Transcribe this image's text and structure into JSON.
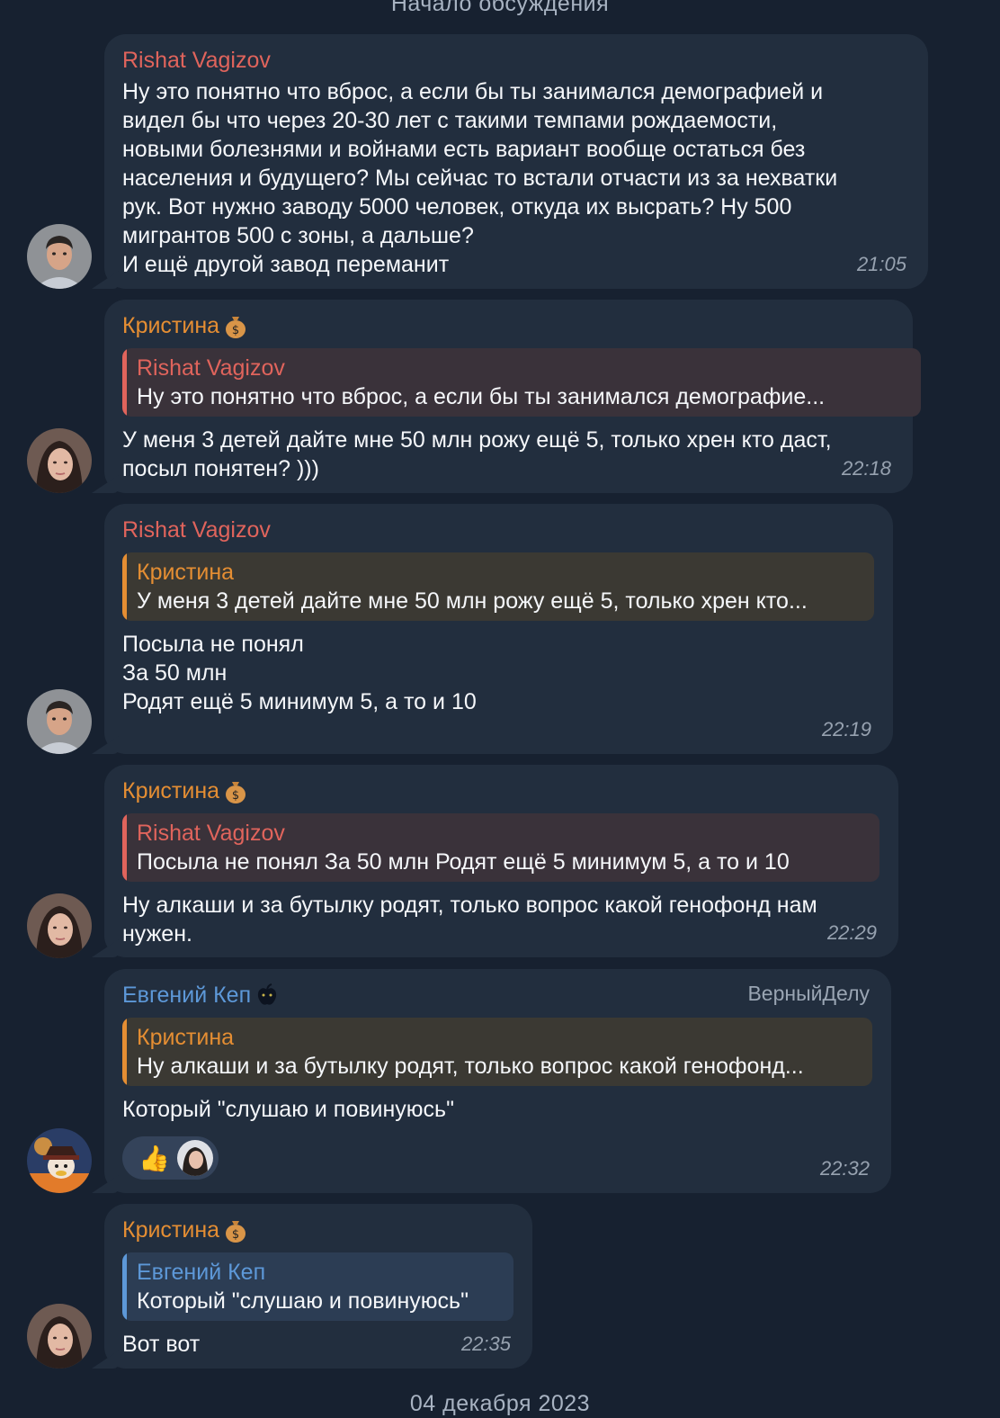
{
  "date_separators": {
    "top": "Начало обсуждения",
    "bottom": "04 декабря 2023"
  },
  "messages": [
    {
      "sender": "Rishat Vagizov",
      "text": "Ну это понятно что вброс, а если бы ты занимался демографией и\nвидел бы что через 20-30 лет с такими темпами рождаемости,\nновыми болезнями и войнами есть вариант вообще остаться без\nнаселения и будущего? Мы сейчас  то встали отчасти из за нехватки\nрук. Вот нужно заводу 5000 человек, откуда их высрать? Ну 500\nмигрантов 500 с зоны, а дальше?\nИ ещё другой завод переманит",
      "time": "21:05"
    },
    {
      "sender": "Кристина",
      "badge_icon": "money-bag-icon",
      "reply_to": {
        "name": "Rishat Vagizov",
        "text": "Ну это понятно что вброс, а если бы ты занимался демографие..."
      },
      "text": "У меня 3 детей дайте мне 50 млн рожу ещё 5, только хрен кто даст,\nпосыл понятен? )))",
      "time": "22:18"
    },
    {
      "sender": "Rishat Vagizov",
      "reply_to": {
        "name": "Кристина",
        "text": "У меня 3 детей дайте мне 50 млн рожу ещё 5, только хрен кто..."
      },
      "text": "Посыла не понял\nЗа 50 млн\nРодят ещё 5 минимум 5, а то и 10",
      "time": "22:19"
    },
    {
      "sender": "Кристина",
      "badge_icon": "money-bag-icon",
      "reply_to": {
        "name": "Rishat Vagizov",
        "text": "Посыла не понял  За 50 млн Родят ещё 5 минимум 5, а то и 10"
      },
      "text": "Ну алкаши и за бутылку родят, только вопрос какой генофонд нам\nнужен.",
      "time": "22:29"
    },
    {
      "sender": "Евгений Кеп",
      "badge_icon": "apple-icon",
      "title": "ВерныйДелу",
      "reply_to": {
        "name": "Кристина",
        "text": "Ну алкаши и за бутылку родят, только вопрос какой генофонд..."
      },
      "text": "Который \"слушаю и повинуюсь\"",
      "reaction": {
        "emoji": "👍",
        "icon": "thumbs-up-icon"
      },
      "time": "22:32"
    },
    {
      "sender": "Кристина",
      "badge_icon": "money-bag-icon",
      "reply_to": {
        "name": "Евгений Кеп",
        "text": "Который \"слушаю и повинуюсь\""
      },
      "text": "Вот вот",
      "time": "22:35"
    }
  ],
  "colors": {
    "background": "#172130",
    "bubble": "#222e3e",
    "name_red": "#e0645c",
    "name_orange": "#e58e33",
    "name_blue": "#5d98d8"
  }
}
